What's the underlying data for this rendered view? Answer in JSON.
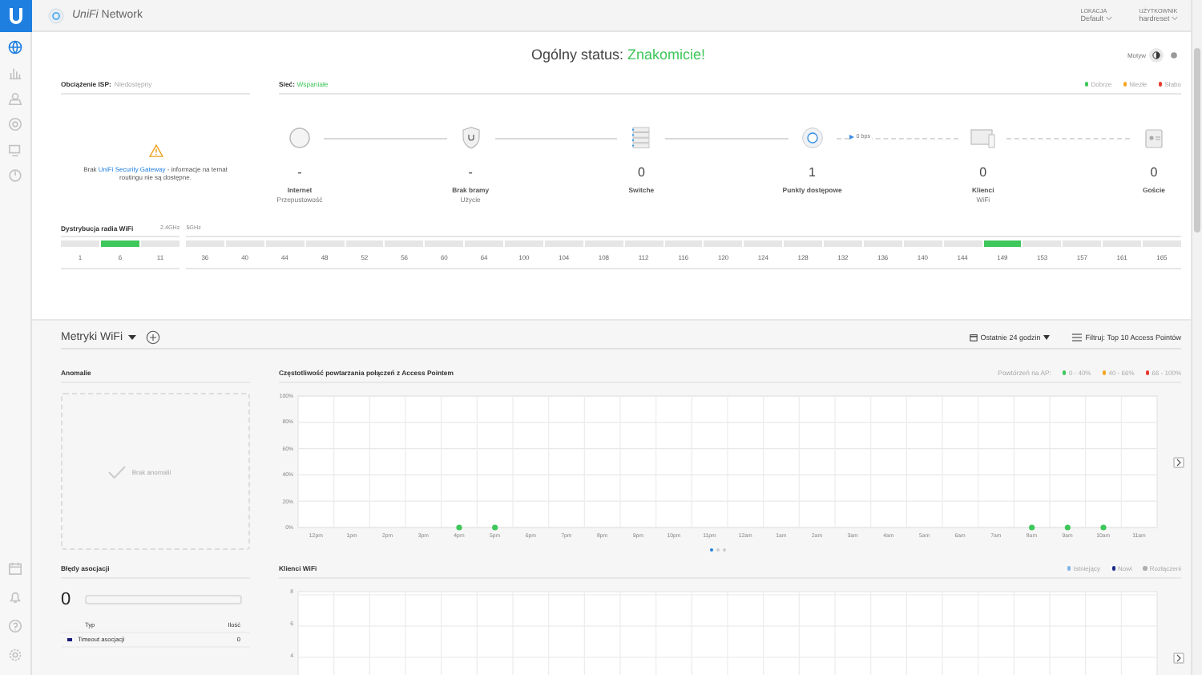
{
  "sidebar": {
    "items": [
      {
        "kind": "dashboard",
        "selected": true
      },
      {
        "kind": "statistics",
        "selected": false
      },
      {
        "kind": "map",
        "selected": false
      },
      {
        "kind": "devices",
        "selected": false
      },
      {
        "kind": "clients",
        "selected": false
      },
      {
        "kind": "insights",
        "selected": false
      }
    ],
    "bottom_items": [
      {
        "kind": "events",
        "selected": false
      },
      {
        "kind": "alerts",
        "selected": false
      },
      {
        "kind": "help",
        "selected": false
      },
      {
        "kind": "settings",
        "selected": false
      }
    ]
  },
  "header": {
    "app_name_brand": "UniFi",
    "app_name": "Network",
    "menus": [
      {
        "caption": "LOKACJA",
        "value": "Default"
      },
      {
        "caption": "UŻYTKOWNIK",
        "value": "hardreset"
      }
    ]
  },
  "status": {
    "label": "Ogólny status:",
    "value": "Znakomicie!"
  },
  "theme": {
    "label": "Motyw",
    "options": [
      {
        "kind": "contrast",
        "selected": true
      },
      {
        "kind": "dot",
        "selected": false
      }
    ]
  },
  "isp": {
    "label": "Obciążenie ISP:",
    "value": "Niedostępny",
    "warning": "Brak",
    "warning_link": "UniFi Security Gateway",
    "warning_rest": "- informacje na temat routingu nie są dostępne."
  },
  "network": {
    "label": "Sieć:",
    "value": "Wspaniałe",
    "legend": [
      {
        "label": "Dobrze",
        "color": "#3ec75a"
      },
      {
        "label": "Niezłe",
        "color": "#f5a623"
      },
      {
        "label": "Słabo",
        "color": "#e8392f"
      }
    ],
    "nodes": [
      {
        "kind": "internet",
        "value": "-",
        "label": "Internet",
        "sublabel": "Przepustowość"
      },
      {
        "kind": "gateway",
        "value": "-",
        "label": "Brak bramy",
        "sublabel": "Użycie"
      },
      {
        "kind": "switch",
        "value": "0",
        "label": "Switche"
      },
      {
        "kind": "ap",
        "value": "1",
        "label": "Punkty dostępowe",
        "throughput": "0 bps"
      },
      {
        "kind": "clients",
        "value": "0",
        "label": "Klienci",
        "sublabel": "WiFi"
      },
      {
        "kind": "guests",
        "value": "0",
        "label": "Goście"
      }
    ],
    "links": [
      {
        "kind": "solid"
      },
      {
        "kind": "solid"
      },
      {
        "kind": "solid"
      },
      {
        "kind": "dashed"
      },
      {
        "kind": "dashed"
      }
    ]
  },
  "radio": {
    "title": "Dystrybucja radia WiFi",
    "bands": [
      {
        "label": "2.4GHz",
        "channels": [
          {
            "label": "1",
            "used": false
          },
          {
            "label": "6",
            "used": true
          },
          {
            "label": "11",
            "used": false
          }
        ]
      },
      {
        "label": "5GHz",
        "channels": [
          {
            "label": "36",
            "used": false
          },
          {
            "label": "40",
            "used": false
          },
          {
            "label": "44",
            "used": false
          },
          {
            "label": "48",
            "used": false
          },
          {
            "label": "52",
            "used": false
          },
          {
            "label": "56",
            "used": false
          },
          {
            "label": "60",
            "used": false
          },
          {
            "label": "64",
            "used": false
          },
          {
            "label": "100",
            "used": false
          },
          {
            "label": "104",
            "used": false
          },
          {
            "label": "108",
            "used": false
          },
          {
            "label": "112",
            "used": false
          },
          {
            "label": "116",
            "used": false
          },
          {
            "label": "120",
            "used": false
          },
          {
            "label": "124",
            "used": false
          },
          {
            "label": "128",
            "used": false
          },
          {
            "label": "132",
            "used": false
          },
          {
            "label": "136",
            "used": false
          },
          {
            "label": "140",
            "used": false
          },
          {
            "label": "144",
            "used": false
          },
          {
            "label": "149",
            "used": true
          },
          {
            "label": "153",
            "used": false
          },
          {
            "label": "157",
            "used": false
          },
          {
            "label": "161",
            "used": false
          },
          {
            "label": "165",
            "used": false
          }
        ]
      }
    ]
  },
  "metrics": {
    "title": "Metryki WiFi",
    "range": "Ostatnie 24 godzin",
    "filter": "Filtruj: Top 10 Access Pointów"
  },
  "anomalies": {
    "title": "Anomalie",
    "empty": "Brak anomalii"
  },
  "reconnect": {
    "title": "Częstotliwość powtarzania połączeń z Access Pointem",
    "legend_label": "Powtórzeń na AP:",
    "chart_data": {
      "type": "scatter",
      "categories": [
        "12pm",
        "1pm",
        "2pm",
        "3pm",
        "4pm",
        "5pm",
        "6pm",
        "7pm",
        "8pm",
        "9pm",
        "10pm",
        "11pm",
        "12am",
        "1am",
        "2am",
        "3am",
        "4am",
        "5am",
        "6am",
        "7am",
        "8am",
        "9am",
        "10am",
        "11am"
      ],
      "series": [
        {
          "name": "0 - 40%",
          "color": "#3ec75a",
          "values": [
            null,
            null,
            null,
            null,
            0,
            0,
            null,
            null,
            null,
            null,
            null,
            null,
            null,
            null,
            null,
            null,
            null,
            null,
            null,
            null,
            0,
            0,
            0,
            null
          ]
        },
        {
          "name": "40 - 66%",
          "color": "#f5a623",
          "values": [
            null,
            null,
            null,
            null,
            null,
            null,
            null,
            null,
            null,
            null,
            null,
            null,
            null,
            null,
            null,
            null,
            null,
            null,
            null,
            null,
            null,
            null,
            null,
            null
          ]
        },
        {
          "name": "66 - 100%",
          "color": "#e8392f",
          "values": [
            null,
            null,
            null,
            null,
            null,
            null,
            null,
            null,
            null,
            null,
            null,
            null,
            null,
            null,
            null,
            null,
            null,
            null,
            null,
            null,
            null,
            null,
            null,
            null
          ]
        }
      ],
      "grid": true,
      "ylim": [
        0,
        100
      ],
      "yticks": [
        {
          "value": 0,
          "label": "0%"
        },
        {
          "value": 20,
          "label": "20%"
        },
        {
          "value": 40,
          "label": "40%"
        },
        {
          "value": 60,
          "label": "60%"
        },
        {
          "value": 80,
          "label": "80%"
        },
        {
          "value": 100,
          "label": "100%"
        }
      ]
    },
    "pages": [
      {
        "selected": true
      },
      {
        "selected": false
      },
      {
        "selected": false
      }
    ]
  },
  "assoc_errors": {
    "title": "Błędy asocjacji",
    "count": "0",
    "level": 0,
    "columns": [
      "Typ",
      "Ilość"
    ],
    "rows": [
      {
        "type": "Timeout asocjacji",
        "count": "0",
        "color": "#1a1a7a"
      }
    ]
  },
  "wifi_clients": {
    "title": "Klienci WiFi",
    "legend": [
      {
        "label": "Istniejący",
        "color": "#7fb3e6"
      },
      {
        "label": "Nowi",
        "color": "#1a2a8a"
      },
      {
        "label": "Rozłączeni",
        "color": "#b0b0b0"
      }
    ],
    "y_labels": [
      "8",
      "6",
      "4"
    ]
  }
}
